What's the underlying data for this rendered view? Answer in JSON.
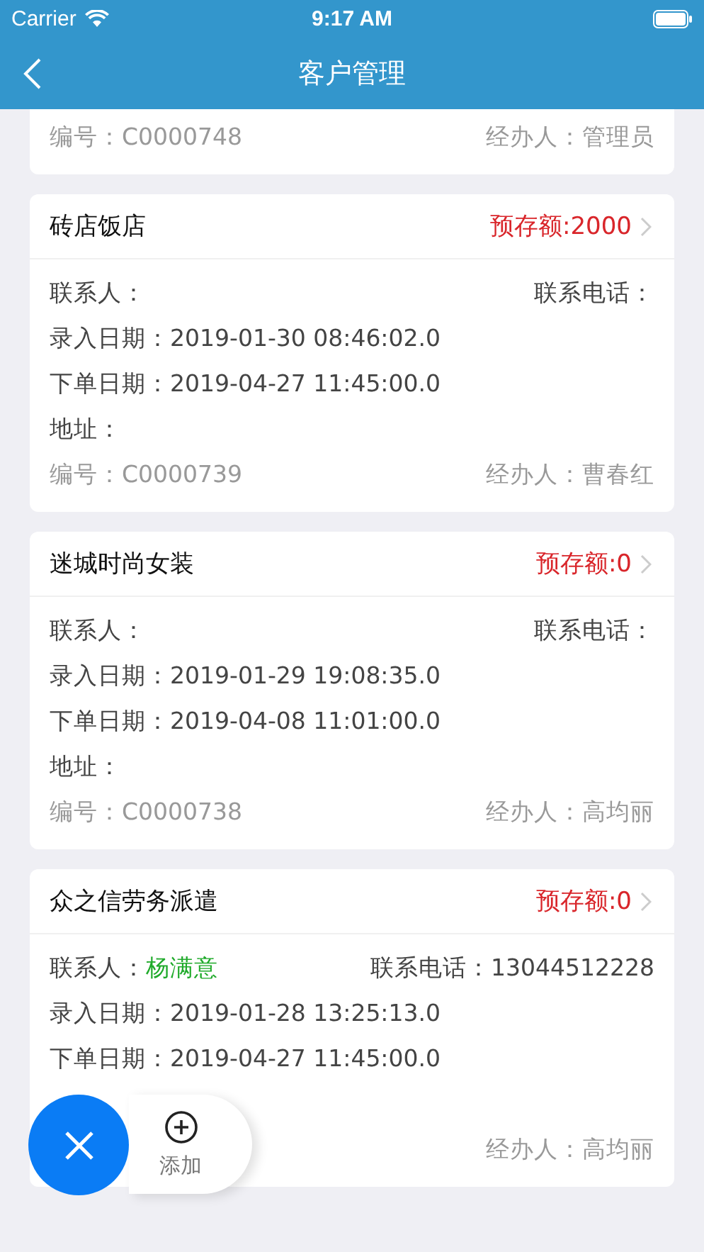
{
  "status_bar": {
    "carrier": "Carrier",
    "time": "9:17 AM"
  },
  "nav": {
    "title": "客户管理"
  },
  "customers": [
    {
      "number_label": "编号：",
      "number": "C0000748",
      "handler_label": "经办人：",
      "handler": "管理员"
    },
    {
      "name": "砖店饭店",
      "deposit": "预存额:2000",
      "contact_label": "联系人：",
      "phone_label": "联系电话：",
      "entry_label": "录入日期：",
      "entry_date": "2019-01-30 08:46:02.0",
      "order_label": "下单日期：",
      "order_date": "2019-04-27 11:45:00.0",
      "address_label": "地址：",
      "number_label": "编号：",
      "number": "C0000739",
      "handler_label": "经办人：",
      "handler": "曹春红"
    },
    {
      "name": "迷城时尚女装",
      "deposit": "预存额:0",
      "contact_label": "联系人：",
      "phone_label": "联系电话：",
      "entry_label": "录入日期：",
      "entry_date": "2019-01-29 19:08:35.0",
      "order_label": "下单日期：",
      "order_date": "2019-04-08 11:01:00.0",
      "address_label": "地址：",
      "number_label": "编号：",
      "number": "C0000738",
      "handler_label": "经办人：",
      "handler": "高均丽"
    },
    {
      "name": "众之信劳务派遣",
      "deposit": "预存额:0",
      "contact_label": "联系人：",
      "contact": "杨满意",
      "phone_label": "联系电话：",
      "phone": "13044512228",
      "entry_label": "录入日期：",
      "entry_date": "2019-01-28 13:25:13.0",
      "order_label": "下单日期：",
      "order_date": "2019-04-27 11:45:00.0",
      "handler_label": "经办人：",
      "handler": "高均丽"
    }
  ],
  "fab": {
    "add_label": "添加"
  }
}
